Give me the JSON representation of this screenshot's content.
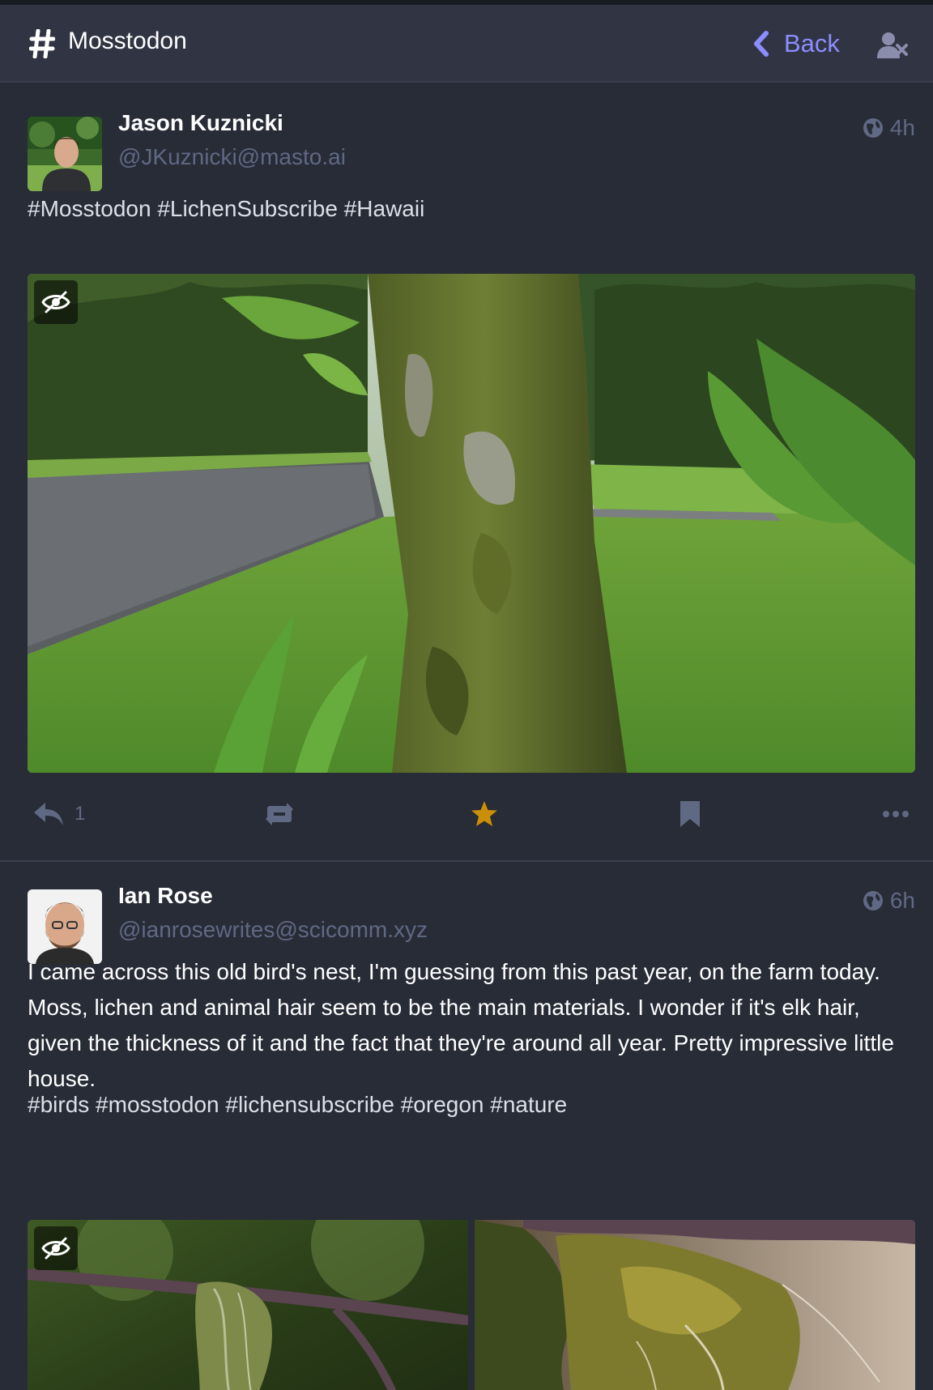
{
  "header": {
    "title": "Mosstodon",
    "back_label": "Back",
    "icons": {
      "hashtag": "hashtag-icon",
      "back": "chevron-left-icon",
      "unfollow": "user-times-icon"
    }
  },
  "colors": {
    "background": "#282c37",
    "header": "#313543",
    "accent": "#8c8dff",
    "muted": "#606984",
    "favourite": "#ca8f04"
  },
  "statuses": [
    {
      "display_name": "Jason Kuznicki",
      "acct": "@JKuznicki@masto.ai",
      "time": "4h",
      "visibility_icon": "globe-icon",
      "hashtags": [
        "#Mosstodon",
        "#LichenSubscribe",
        "#Hawaii"
      ],
      "media_count": 1,
      "replies": "1",
      "favourited": true
    },
    {
      "display_name": "Ian Rose",
      "acct": "@ianrosewrites@scicomm.xyz",
      "time": "6h",
      "visibility_icon": "globe-icon",
      "text": "I came across this old bird's nest, I'm guessing from this past year, on the farm today. Moss, lichen and animal hair seem to be the main materials. I wonder if it's elk hair, given the thickness of it and the fact that they're around all year. Pretty impressive little house.",
      "hashtags": [
        "#birds",
        "#mosstodon",
        "#lichensubscribe",
        "#oregon",
        "#nature"
      ],
      "media_count": 2
    }
  ]
}
